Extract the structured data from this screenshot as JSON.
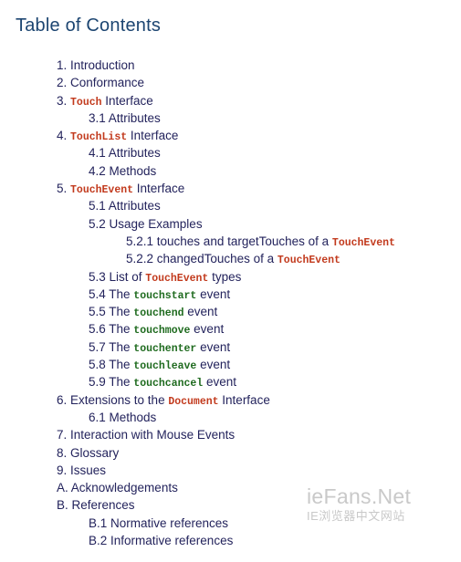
{
  "page": {
    "title": "Table of Contents",
    "title_color": "#1c4571",
    "text_color": "#23235c",
    "background": "#ffffff",
    "code_red_color": "#c23a1d",
    "code_green_color": "#1f6b1f"
  },
  "toc": {
    "items": [
      {
        "level": 1,
        "parts": [
          {
            "text": "1. Introduction",
            "style": "plain"
          }
        ]
      },
      {
        "level": 1,
        "parts": [
          {
            "text": "2. Conformance",
            "style": "plain"
          }
        ]
      },
      {
        "level": 1,
        "parts": [
          {
            "text": "3. ",
            "style": "plain"
          },
          {
            "text": "Touch",
            "style": "code-red"
          },
          {
            "text": " Interface",
            "style": "plain"
          }
        ]
      },
      {
        "level": 2,
        "parts": [
          {
            "text": "3.1 Attributes",
            "style": "plain"
          }
        ]
      },
      {
        "level": 1,
        "parts": [
          {
            "text": "4. ",
            "style": "plain"
          },
          {
            "text": "TouchList",
            "style": "code-red"
          },
          {
            "text": " Interface",
            "style": "plain"
          }
        ]
      },
      {
        "level": 2,
        "parts": [
          {
            "text": "4.1 Attributes",
            "style": "plain"
          }
        ]
      },
      {
        "level": 2,
        "parts": [
          {
            "text": "4.2 Methods",
            "style": "plain"
          }
        ]
      },
      {
        "level": 1,
        "parts": [
          {
            "text": "5. ",
            "style": "plain"
          },
          {
            "text": "TouchEvent",
            "style": "code-red"
          },
          {
            "text": " Interface",
            "style": "plain"
          }
        ]
      },
      {
        "level": 2,
        "parts": [
          {
            "text": "5.1 Attributes",
            "style": "plain"
          }
        ]
      },
      {
        "level": 2,
        "parts": [
          {
            "text": "5.2 Usage Examples",
            "style": "plain"
          }
        ]
      },
      {
        "level": 3,
        "parts": [
          {
            "text": "5.2.1 touches and targetTouches of a ",
            "style": "plain"
          },
          {
            "text": "TouchEvent",
            "style": "code-red"
          }
        ]
      },
      {
        "level": 3,
        "parts": [
          {
            "text": "5.2.2 changedTouches of a ",
            "style": "plain"
          },
          {
            "text": "TouchEvent",
            "style": "code-red"
          }
        ]
      },
      {
        "level": 2,
        "parts": [
          {
            "text": "5.3 List of ",
            "style": "plain"
          },
          {
            "text": "TouchEvent",
            "style": "code-red"
          },
          {
            "text": " types",
            "style": "plain"
          }
        ]
      },
      {
        "level": 2,
        "parts": [
          {
            "text": "5.4 The ",
            "style": "plain"
          },
          {
            "text": "touchstart",
            "style": "code-green"
          },
          {
            "text": " event",
            "style": "plain"
          }
        ]
      },
      {
        "level": 2,
        "parts": [
          {
            "text": "5.5 The ",
            "style": "plain"
          },
          {
            "text": "touchend",
            "style": "code-green"
          },
          {
            "text": " event",
            "style": "plain"
          }
        ]
      },
      {
        "level": 2,
        "parts": [
          {
            "text": "5.6 The ",
            "style": "plain"
          },
          {
            "text": "touchmove",
            "style": "code-green"
          },
          {
            "text": " event",
            "style": "plain"
          }
        ]
      },
      {
        "level": 2,
        "parts": [
          {
            "text": "5.7 The ",
            "style": "plain"
          },
          {
            "text": "touchenter",
            "style": "code-green"
          },
          {
            "text": " event",
            "style": "plain"
          }
        ]
      },
      {
        "level": 2,
        "parts": [
          {
            "text": "5.8 The ",
            "style": "plain"
          },
          {
            "text": "touchleave",
            "style": "code-green"
          },
          {
            "text": " event",
            "style": "plain"
          }
        ]
      },
      {
        "level": 2,
        "parts": [
          {
            "text": "5.9 The ",
            "style": "plain"
          },
          {
            "text": "touchcancel",
            "style": "code-green"
          },
          {
            "text": " event",
            "style": "plain"
          }
        ]
      },
      {
        "level": 1,
        "parts": [
          {
            "text": "6. Extensions to the ",
            "style": "plain"
          },
          {
            "text": "Document",
            "style": "code-red"
          },
          {
            "text": " Interface",
            "style": "plain"
          }
        ]
      },
      {
        "level": 2,
        "parts": [
          {
            "text": "6.1 Methods",
            "style": "plain"
          }
        ]
      },
      {
        "level": 1,
        "parts": [
          {
            "text": "7. Interaction with Mouse Events",
            "style": "plain"
          }
        ]
      },
      {
        "level": 1,
        "parts": [
          {
            "text": "8. Glossary",
            "style": "plain"
          }
        ]
      },
      {
        "level": 1,
        "parts": [
          {
            "text": "9. Issues",
            "style": "plain"
          }
        ]
      },
      {
        "level": 1,
        "parts": [
          {
            "text": "A. Acknowledgements",
            "style": "plain"
          }
        ]
      },
      {
        "level": 1,
        "parts": [
          {
            "text": "B. References",
            "style": "plain"
          }
        ]
      },
      {
        "level": 2,
        "parts": [
          {
            "text": "B.1 Normative references",
            "style": "plain"
          }
        ]
      },
      {
        "level": 2,
        "parts": [
          {
            "text": "B.2 Informative references",
            "style": "plain"
          }
        ]
      }
    ]
  },
  "watermark": {
    "main": "ieFans.Net",
    "sub": "IE浏览器中文网站",
    "color": "#c9c9c9"
  }
}
